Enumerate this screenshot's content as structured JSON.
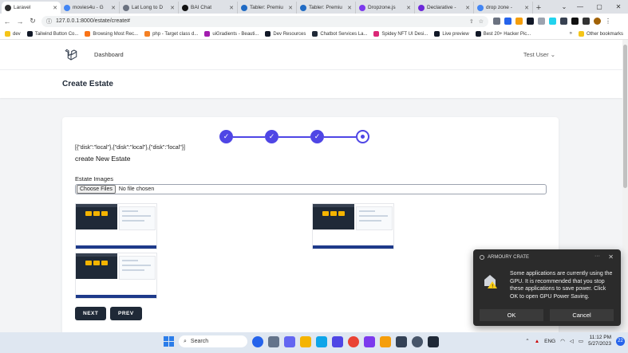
{
  "browser": {
    "tabs": [
      {
        "title": "Laravel",
        "color": "#2d2d2d",
        "active": true
      },
      {
        "title": "movies4u - G",
        "color": "#4285f4"
      },
      {
        "title": "Lat Long to D",
        "color": "#6b7280"
      },
      {
        "title": "BAI Chat",
        "color": "#111111"
      },
      {
        "title": "Tabler: Premiu",
        "color": "#206bc4"
      },
      {
        "title": "Tabler: Premiu",
        "color": "#206bc4"
      },
      {
        "title": "Dropzone.js",
        "color": "#7c3aed"
      },
      {
        "title": "Declarative -",
        "color": "#6d28d9"
      },
      {
        "title": "drop zone -",
        "color": "#4285f4"
      }
    ],
    "url": "127.0.0.1:8000/estate/create#",
    "bookmarks": [
      {
        "label": "dev",
        "color": "#f5c518"
      },
      {
        "label": "Tailwind Button Co...",
        "color": "#111827"
      },
      {
        "label": "Browsing Most Rec...",
        "color": "#f97316"
      },
      {
        "label": "php - Target class d...",
        "color": "#f48024"
      },
      {
        "label": "uiGradients - Beauti...",
        "color": "#a21caf"
      },
      {
        "label": "Dev Resources",
        "color": "#111827"
      },
      {
        "label": "Chatbot Services La...",
        "color": "#1f2937"
      },
      {
        "label": "Spidey NFT UI Desi...",
        "color": "#db2777"
      },
      {
        "label": "Live preview",
        "color": "#111827"
      },
      {
        "label": "Best 20+ Hacker Pic...",
        "color": "#111827"
      }
    ],
    "bookmarks_more": "»",
    "other_bookmarks": "Other bookmarks"
  },
  "app": {
    "nav_link": "Dashboard",
    "user": "Test User",
    "page_title": "Create Estate",
    "disks_text": "[{\"disk\":\"local\"},{\"disk\":\"local\"},{\"disk\":\"local\"}]",
    "form_title": "create New Estate",
    "images_label": "Estate Images",
    "choose_files": "Choose Files",
    "no_file": "No file chosen",
    "next_label": "NEXT",
    "prev_label": "PREV",
    "accent": "#4f46e5",
    "steps_completed": 3,
    "steps_total": 4
  },
  "toast": {
    "app_name": "ARMOURY CRATE",
    "more": "···",
    "message": "Some applications are currently using the GPU. It is recommended that you stop these applications to save power. Click OK to open GPU Power Saving.",
    "ok_label": "OK",
    "cancel_label": "Cancel"
  },
  "taskbar": {
    "search_label": "Search",
    "lang": "ENG",
    "time": "11:12 PM",
    "date": "5/27/2023",
    "notif_count": "22"
  }
}
